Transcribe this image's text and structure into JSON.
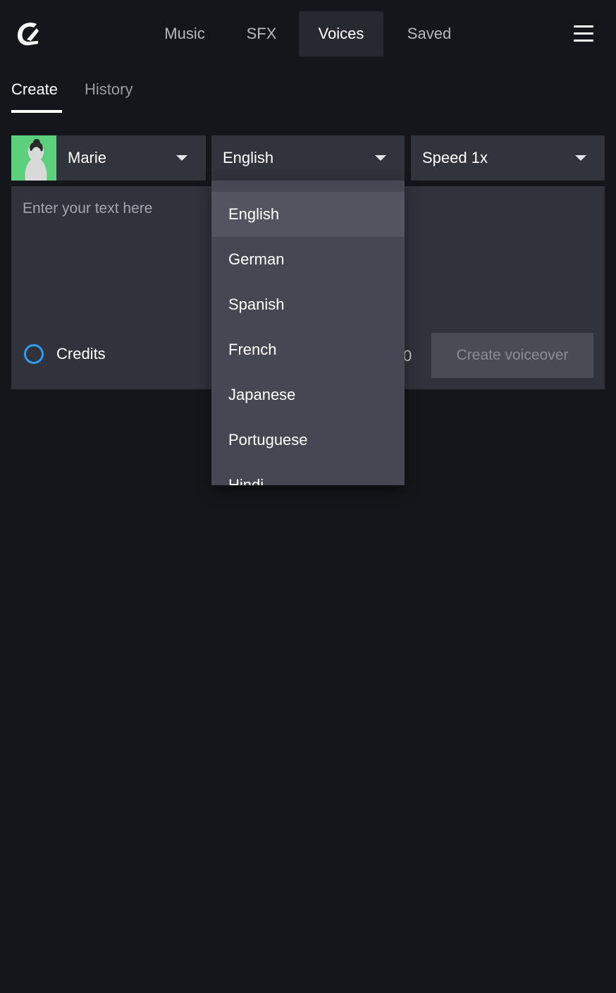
{
  "nav": {
    "tabs": [
      {
        "label": "Music"
      },
      {
        "label": "SFX"
      },
      {
        "label": "Voices"
      },
      {
        "label": "Saved"
      }
    ],
    "active_tab": "Voices"
  },
  "subtabs": {
    "create": "Create",
    "history": "History"
  },
  "voice": {
    "name": "Marie",
    "avatar_color": "#5bd17b"
  },
  "language": {
    "selected": "English",
    "options": [
      "English",
      "German",
      "Spanish",
      "French",
      "Japanese",
      "Portuguese",
      "Hindi"
    ]
  },
  "speed": {
    "label": "Speed 1x"
  },
  "editor": {
    "placeholder": "Enter your text here",
    "value": ""
  },
  "footer": {
    "credits_label": "Credits",
    "char_count": "0",
    "create_button": "Create voiceover"
  },
  "colors": {
    "background": "#15161b",
    "panel": "#32343d",
    "dropdown": "#454852",
    "credits_ring": "#2f9bf0"
  }
}
